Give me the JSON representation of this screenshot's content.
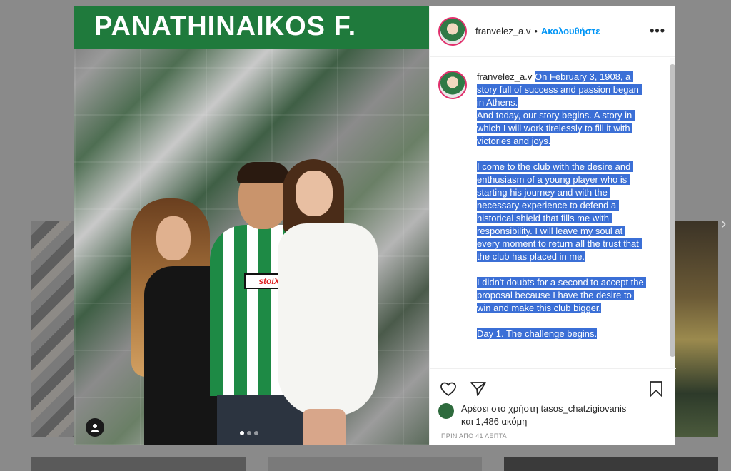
{
  "photo": {
    "banner_text": "PANATHINAIKOS F.",
    "sponsor_text": "stoiX",
    "carousel_count": 3,
    "carousel_active": 1
  },
  "header": {
    "username": "franvelez_a.v",
    "separator": "•",
    "follow_label": "Ακολουθήστε",
    "more_icon": "more-dots-icon",
    "more_label": "•••"
  },
  "caption": {
    "username": "franvelez_a.v",
    "paragraphs": [
      "On February 3, 1908, a story full of success and passion began in Athens.\nAnd today, our story begins. A story in which I will work tirelessly to fill it with victories and joys.",
      "I come to the club with the desire and enthusiasm of a young player who is starting his journey and with the necessary experience to defend a historical shield that fills me with responsibility. I will leave my soul at every moment to return all the trust that the club has placed in me.",
      "I didn't doubts for a second to accept the proposal because I have the desire to win and make this club bigger.",
      "Day 1. The challenge begins."
    ]
  },
  "actions": {
    "like_icon": "heart-icon",
    "share_icon": "send-icon",
    "save_icon": "bookmark-icon"
  },
  "likes": {
    "line1": "Αρέσει στο χρήστη tasos_chatzigiovanis",
    "line2": "και 1,486 ακόμη"
  },
  "timestamp": "ΠΡΙΝ ΑΠΟ 41 ΛΕΠΤΑ",
  "colors": {
    "link": "#0095f6",
    "highlight": "#3b6fd6",
    "banner_green": "#1f7a3c"
  }
}
